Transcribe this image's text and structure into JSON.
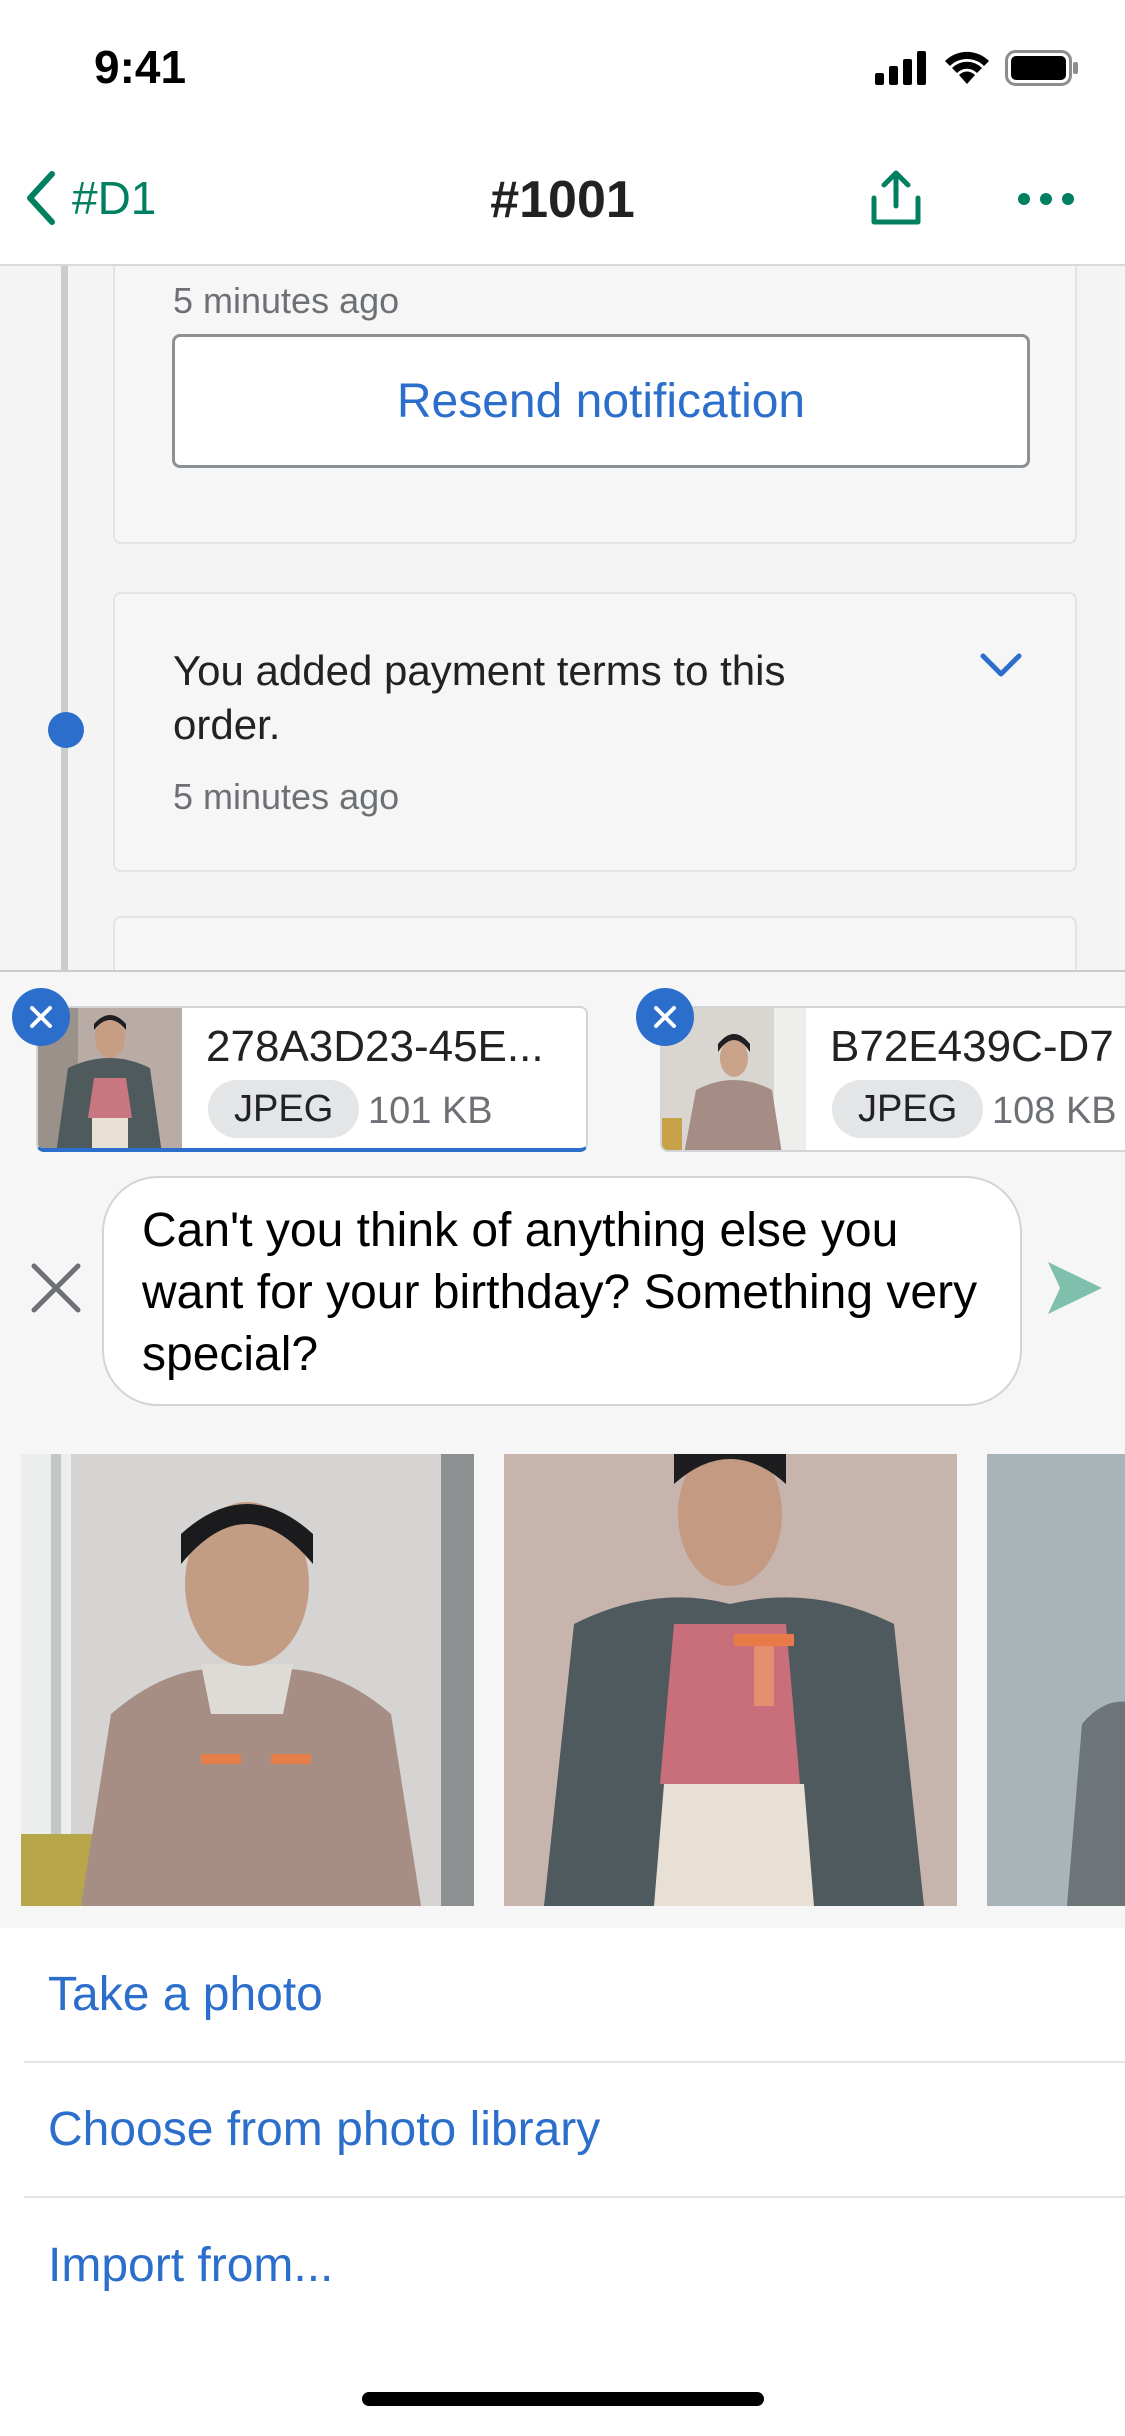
{
  "status_bar": {
    "time": "9:41"
  },
  "nav": {
    "back_label": "#D1",
    "title": "#1001"
  },
  "timeline": {
    "card1": {
      "time": "5 minutes ago",
      "button_label": "Resend notification"
    },
    "card2": {
      "text": "You added payment terms to this order.",
      "time": "5 minutes ago"
    }
  },
  "attachments": [
    {
      "name": "278A3D23-45E...",
      "type": "JPEG",
      "size": "101 KB"
    },
    {
      "name": "B72E439C-D7",
      "type": "JPEG",
      "size": "108 KB"
    }
  ],
  "message": {
    "text": "Can't you think of anything else you want for your birthday? Something very special?"
  },
  "action_sheet": {
    "take_photo": "Take a photo",
    "choose_library": "Choose from photo library",
    "import_from": "Import from..."
  },
  "colors": {
    "accent_green": "#008060",
    "link_blue": "#2c6ecb",
    "send_green_faded": "#7fc0ad"
  },
  "icons": [
    "back-chevron-icon",
    "share-icon",
    "more-icon",
    "chevron-down-icon",
    "remove-attachment-icon",
    "close-icon",
    "send-icon"
  ]
}
